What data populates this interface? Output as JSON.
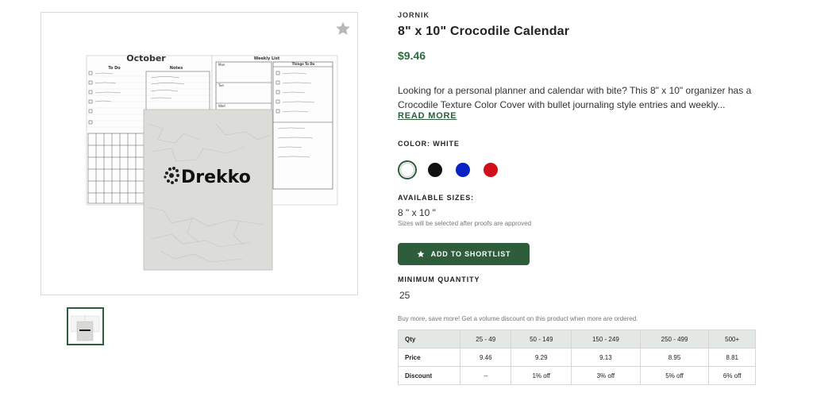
{
  "product": {
    "brand": "JORNIK",
    "title": "8\" x 10\" Crocodile Calendar",
    "price": "$9.46",
    "description": "Looking for a personal planner and calendar with bite? This 8\" x 10\" organizer has a Crocodile Texture Color Cover with bullet journaling style entries and weekly...",
    "read_more_label": "READ MORE"
  },
  "image": {
    "calendar_heading": "October",
    "todo_heading": "To Do",
    "notes_heading": "Notes",
    "weekly_heading": "Weekly List",
    "things_heading": "Things To Do",
    "logo_text": "Drekko",
    "day_labels": [
      "Mon",
      "Tue",
      "Wed"
    ]
  },
  "color": {
    "label": "COLOR: WHITE",
    "options": [
      {
        "name": "white",
        "hex": "#ffffff",
        "selected": true
      },
      {
        "name": "black",
        "hex": "#111111",
        "selected": false
      },
      {
        "name": "blue",
        "hex": "#0a22c4",
        "selected": false
      },
      {
        "name": "red",
        "hex": "#d0111b",
        "selected": false
      }
    ]
  },
  "sizes": {
    "label": "AVAILABLE SIZES:",
    "value": "8 \" x 10 \"",
    "note": "Sizes will be selected after proofs are approved"
  },
  "shortlist_button": "ADD TO SHORTLIST",
  "min_qty": {
    "label": "MINIMUM QUANTITY",
    "value": "25"
  },
  "bulk_note": "Buy more, save more! Get a volume discount on this product when more are ordered.",
  "pricing": {
    "headers": [
      "Qty",
      "25 - 49",
      "50 - 149",
      "150 - 249",
      "250 - 499",
      "500+"
    ],
    "price_label": "Price",
    "prices": [
      "9.46",
      "9.29",
      "9.13",
      "8.95",
      "8.81"
    ],
    "discount_label": "Discount",
    "discounts": [
      "--",
      "1% off",
      "3% off",
      "5% off",
      "6% off"
    ]
  },
  "accent_color": "#2e5d3c",
  "price_color": "#2e6b3c"
}
